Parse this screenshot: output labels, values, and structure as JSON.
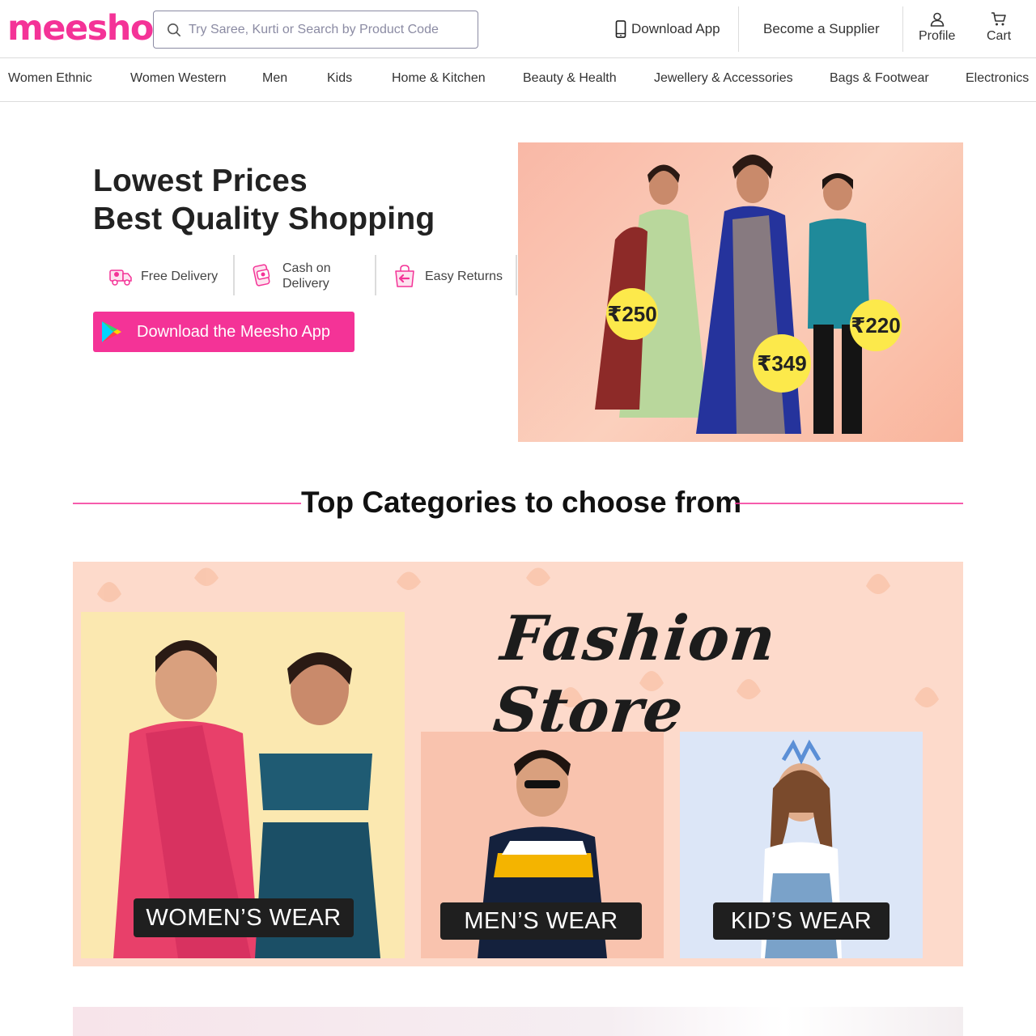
{
  "header": {
    "logo": "meesho",
    "search_placeholder": "Try Saree, Kurti or Search by Product Code",
    "download_app": "Download App",
    "become_supplier": "Become a Supplier",
    "profile": "Profile",
    "cart": "Cart"
  },
  "nav": {
    "items": [
      "Women Ethnic",
      "Women Western",
      "Men",
      "Kids",
      "Home & Kitchen",
      "Beauty & Health",
      "Jewellery & Accessories",
      "Bags & Footwear",
      "Electronics"
    ]
  },
  "hero": {
    "title_line1": "Lowest Prices",
    "title_line2": "Best Quality Shopping",
    "features": [
      {
        "icon": "truck-icon",
        "line1": "Free Delivery",
        "line2": ""
      },
      {
        "icon": "cash-icon",
        "line1": "Cash on",
        "line2": "Delivery"
      },
      {
        "icon": "return-bag-icon",
        "line1": "Easy Returns",
        "line2": ""
      }
    ],
    "download_button": "Download the Meesho App",
    "prices": [
      "₹250",
      "₹349",
      "₹220"
    ]
  },
  "categories": {
    "heading": "Top Categories to choose from",
    "fashion_title": "Fashion Store",
    "cards": [
      "WOMEN’S WEAR",
      "MEN’S WEAR",
      "KID’S WEAR"
    ]
  },
  "colors": {
    "brand": "#f43397",
    "badge": "#fce94b",
    "fashion_bg": "#fddacb"
  }
}
